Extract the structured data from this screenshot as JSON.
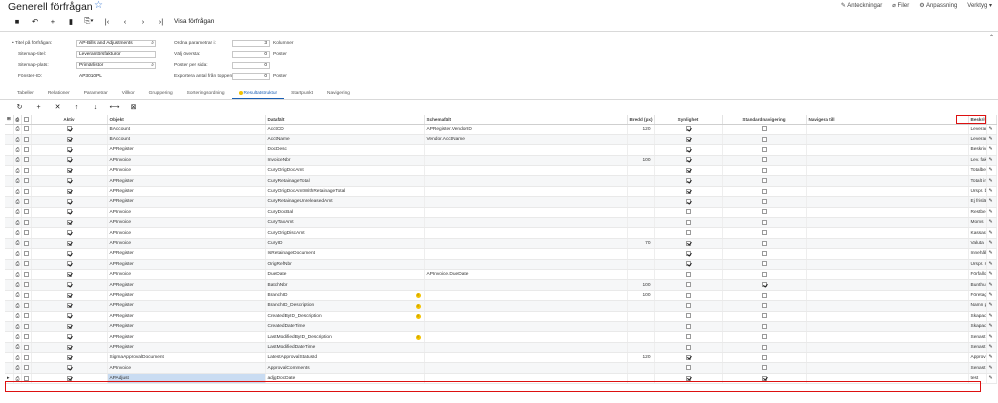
{
  "header": {
    "title": "Generell förfrågan",
    "links": [
      {
        "label": "Anteckningar",
        "icon": "edit-icon"
      },
      {
        "label": "Filer",
        "icon": "paperclip-icon"
      },
      {
        "label": "Anpassning",
        "icon": "customize-icon"
      },
      {
        "label": "Verktyg ▾",
        "icon": ""
      }
    ]
  },
  "toolbar": {
    "show_query_label": "Visa förfrågan"
  },
  "form": {
    "title_label": "• Titel på förfrågan:",
    "title_value": "AP-Bills and Adjustments",
    "sitemap_title_label": "Sitemap-titel:",
    "sitemap_title_value": "Leverantörsfakturor",
    "sitemap_location_label": "Sitemap-plats:",
    "sitemap_location_value": "Primärlistor",
    "screen_id_label": "Fönster-ID:",
    "screen_id_value": "AP3010PL",
    "row_params_label": "Ordna parametrar i:",
    "row_params_value": "3",
    "row_params_unit": "Kolumner",
    "select_top_label": "Välj översta:",
    "select_top_value": "0",
    "select_top_unit": "Poster",
    "records_per_page_label": "Poster per sida:",
    "records_per_page_value": "0",
    "export_top_label": "Exportera antal från toppen:",
    "export_top_value": "0",
    "export_top_unit": "Poster"
  },
  "tabs": [
    "Tabeller",
    "Relationer",
    "Parametrar",
    "Villkor",
    "Gruppering",
    "Sorteringsordning",
    "Resultatstruktur",
    "Startpunkt",
    "Navigering"
  ],
  "active_tab": "Resultatstruktur",
  "grid": {
    "columns": {
      "active": "Aktiv",
      "object": "Objekt",
      "data_field": "Datafält",
      "schema_field": "Schemafält",
      "width": "Bredd (px)",
      "visible": "Synlighet",
      "default_nav": "Standardnavigering",
      "navigate_to": "Navigera till",
      "caption": "Beskrivning"
    },
    "rows": [
      {
        "active": true,
        "object": "BAccount",
        "field": "AcctCD",
        "schema": "APRegister.VendorID",
        "width": "120",
        "visible": true,
        "defnav": false,
        "caption": "Leverantör",
        "red": false,
        "warn": false
      },
      {
        "active": true,
        "object": "BAccount",
        "field": "AcctName",
        "schema": "Vendor.AcctName",
        "width": "",
        "visible": true,
        "defnav": false,
        "caption": "Leverant...",
        "red": false,
        "warn": false
      },
      {
        "active": true,
        "object": "APRegister",
        "field": "DocDesc",
        "schema": "",
        "width": "",
        "visible": true,
        "defnav": false,
        "caption": "Beskrivning",
        "red": false,
        "warn": false
      },
      {
        "active": true,
        "object": "APInvoice",
        "field": "InvoiceNbr",
        "schema": "",
        "width": "100",
        "visible": true,
        "defnav": false,
        "caption": "Lev. faktu...",
        "red": false,
        "warn": false
      },
      {
        "active": true,
        "object": "APInvoice",
        "field": "CuryOrigDocAmt",
        "schema": "",
        "width": "",
        "visible": true,
        "defnav": false,
        "caption": "Totalbelopp",
        "red": false,
        "warn": false
      },
      {
        "active": true,
        "object": "APRegister",
        "field": "CuryRetainageTotal",
        "schema": "",
        "width": "",
        "visible": true,
        "defnav": false,
        "caption": "Totalt inn...",
        "red": false,
        "warn": false
      },
      {
        "active": true,
        "object": "APRegister",
        "field": "CuryOrigDocAmtWithRetainageTotal",
        "schema": "",
        "width": "",
        "visible": true,
        "defnav": false,
        "caption": "Urspr. bel...",
        "red": false,
        "warn": false
      },
      {
        "active": true,
        "object": "APRegister",
        "field": "CuryRetainageUnreleasedAmt",
        "schema": "",
        "width": "",
        "visible": true,
        "defnav": false,
        "caption": "Ej frisläp...",
        "red": false,
        "warn": false
      },
      {
        "active": true,
        "object": "APInvoice",
        "field": "CuryDocBal",
        "schema": "",
        "width": "",
        "visible": false,
        "defnav": false,
        "caption": "Restbelopp",
        "red": false,
        "warn": false
      },
      {
        "active": true,
        "object": "APInvoice",
        "field": "CuryTaxAmt",
        "schema": "",
        "width": "",
        "visible": false,
        "defnav": false,
        "caption": "Moms",
        "red": false,
        "warn": false
      },
      {
        "active": true,
        "object": "APInvoice",
        "field": "CuryOrigDiscAmt",
        "schema": "",
        "width": "",
        "visible": false,
        "defnav": false,
        "caption": "Kassarab...",
        "red": false,
        "warn": false
      },
      {
        "active": true,
        "object": "APInvoice",
        "field": "CuryID",
        "schema": "",
        "width": "70",
        "visible": true,
        "defnav": false,
        "caption": "Valuta",
        "red": false,
        "warn": false
      },
      {
        "active": true,
        "object": "APRegister",
        "field": "IsRetainageDocument",
        "schema": "",
        "width": "",
        "visible": true,
        "defnav": false,
        "caption": "Innehålle...",
        "red": false,
        "warn": false
      },
      {
        "active": true,
        "object": "APRegister",
        "field": "OrigRefNbr",
        "schema": "",
        "width": "",
        "visible": true,
        "defnav": false,
        "caption": "Urspr. ref.nr",
        "red": false,
        "warn": false
      },
      {
        "active": true,
        "object": "APInvoice",
        "field": "DueDate",
        "schema": "APInvoice.DueDate",
        "width": "",
        "visible": false,
        "defnav": false,
        "caption": "Förfallod...",
        "red": false,
        "warn": false
      },
      {
        "active": true,
        "object": "APRegister",
        "field": "BatchNbr",
        "schema": "",
        "width": "100",
        "visible": false,
        "defnav": true,
        "caption": "Bunthum...",
        "red": false,
        "warn": false
      },
      {
        "active": true,
        "object": "APRegister",
        "field": "BranchID",
        "schema": "",
        "width": "100",
        "visible": false,
        "defnav": false,
        "caption": "Företags...",
        "red": true,
        "warn": true
      },
      {
        "active": true,
        "object": "APRegister",
        "field": "BranchID_Description",
        "schema": "",
        "width": "",
        "visible": false,
        "defnav": false,
        "caption": "Namn på ...",
        "red": true,
        "warn": true
      },
      {
        "active": true,
        "object": "APRegister",
        "field": "CreatedByID_Description",
        "schema": "",
        "width": "",
        "visible": false,
        "defnav": false,
        "caption": "Skapad av",
        "red": true,
        "warn": true
      },
      {
        "active": true,
        "object": "APRegister",
        "field": "CreatedDateTime",
        "schema": "",
        "width": "",
        "visible": false,
        "defnav": false,
        "caption": "Skapad d...",
        "red": false,
        "warn": false
      },
      {
        "active": true,
        "object": "APRegister",
        "field": "LastModifiedByID_Description",
        "schema": "",
        "width": "",
        "visible": false,
        "defnav": false,
        "caption": "Senast ä...",
        "red": true,
        "warn": true
      },
      {
        "active": true,
        "object": "APRegister",
        "field": "LastModifiedDateTime",
        "schema": "",
        "width": "",
        "visible": false,
        "defnav": false,
        "caption": "Senast ä...",
        "red": false,
        "warn": false
      },
      {
        "active": true,
        "object": "SigmaApprovalDocument",
        "field": "LatestApprovalStatusId",
        "schema": "",
        "width": "120",
        "visible": true,
        "defnav": false,
        "caption": "Approval...",
        "red": false,
        "warn": false
      },
      {
        "active": true,
        "object": "APInvoice",
        "field": "ApprovalComments",
        "schema": "",
        "width": "",
        "visible": false,
        "defnav": false,
        "caption": "Senast k...",
        "red": false,
        "warn": false
      },
      {
        "active": true,
        "object": "APAdjust",
        "field": "adjgDocDate",
        "schema": "",
        "width": "",
        "visible": true,
        "defnav": true,
        "caption": "test",
        "red": false,
        "warn": false
      }
    ]
  }
}
